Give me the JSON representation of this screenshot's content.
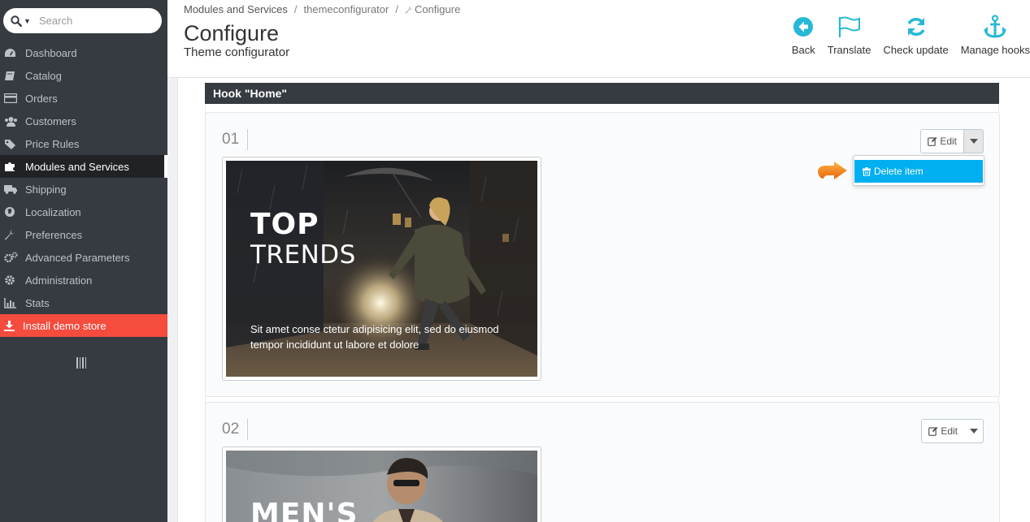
{
  "search": {
    "placeholder": "Search"
  },
  "sidebar": {
    "items": [
      {
        "label": "Dashboard",
        "icon": "dashboard-icon"
      },
      {
        "label": "Catalog",
        "icon": "book-icon"
      },
      {
        "label": "Orders",
        "icon": "credit-card-icon"
      },
      {
        "label": "Customers",
        "icon": "users-icon"
      },
      {
        "label": "Price Rules",
        "icon": "tags-icon"
      },
      {
        "label": "Modules and Services",
        "icon": "puzzle-icon",
        "active": true
      },
      {
        "label": "Shipping",
        "icon": "truck-icon"
      },
      {
        "label": "Localization",
        "icon": "globe-icon"
      },
      {
        "label": "Preferences",
        "icon": "wrench-icon"
      },
      {
        "label": "Advanced Parameters",
        "icon": "cogs-icon"
      },
      {
        "label": "Administration",
        "icon": "gear-icon"
      },
      {
        "label": "Stats",
        "icon": "bar-chart-icon"
      }
    ],
    "install": {
      "label": "Install demo store",
      "icon": "download-icon",
      "color": "#f54c3e"
    }
  },
  "breadcrumb": {
    "items": [
      "Modules and Services",
      "themeconfigurator",
      "Configure"
    ],
    "separator": "/"
  },
  "header": {
    "title": "Configure",
    "subtitle": "Theme configurator"
  },
  "toolbar": {
    "back": "Back",
    "translate": "Translate",
    "check_update": "Check update",
    "manage_hooks": "Manage hooks",
    "accent": "#25b9d7"
  },
  "hook": {
    "title": "Hook \"Home\""
  },
  "items": [
    {
      "number": "01",
      "edit_label": "Edit",
      "banner": {
        "title": "TOP",
        "subtitle": "TRENDS",
        "text": "Sit amet conse ctetur adipisicing elit, sed do eiusmod tempor incididunt ut labore et dolore"
      }
    },
    {
      "number": "02",
      "edit_label": "Edit",
      "banner": {
        "title": "MEN'S"
      }
    }
  ],
  "dropdown": {
    "delete_label": "Delete item",
    "color": "#00aff0"
  },
  "colors": {
    "sidebar": "#363a41",
    "pointer": "#f7931e"
  }
}
